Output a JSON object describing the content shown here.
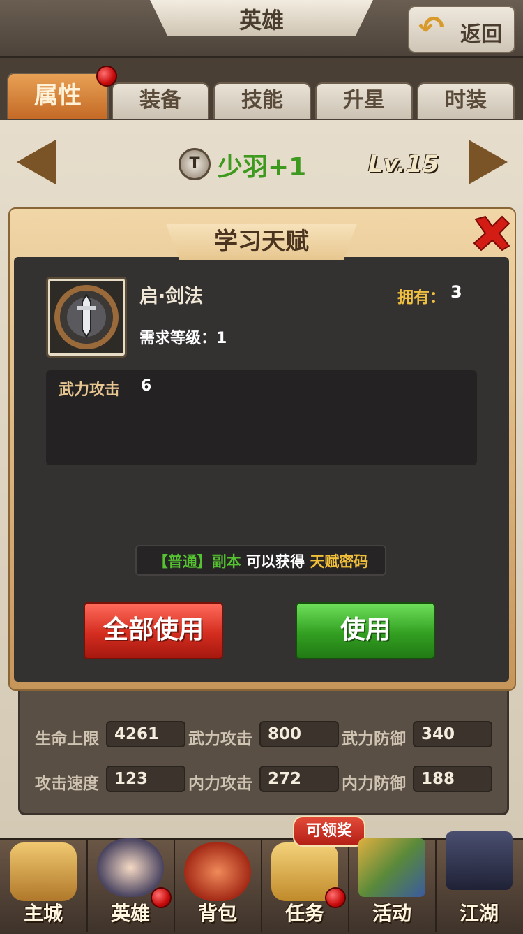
{
  "header": {
    "title": "英雄",
    "back_label": "返回"
  },
  "tabs": [
    {
      "label": "属性",
      "active": true
    },
    {
      "label": "装备"
    },
    {
      "label": "技能"
    },
    {
      "label": "升星"
    },
    {
      "label": "时装"
    }
  ],
  "hero": {
    "rank_icon_text": "T",
    "name": "少羽+1",
    "level": "Lv.15"
  },
  "dialog": {
    "title": "学习天赋",
    "item_name": "启·剑法",
    "own_label": "拥有：",
    "own_value": "3",
    "required_level": "需求等级：1",
    "effect_stat": "武力攻击",
    "effect_value": "6",
    "source": {
      "part1": "【普通】副本",
      "part2": " 可以获得 ",
      "part3": "天赋密码"
    },
    "use_all_label": "全部使用",
    "use_label": "使用"
  },
  "stats": [
    {
      "label": "生命上限",
      "value": "4261"
    },
    {
      "label": "武力攻击",
      "value": "800"
    },
    {
      "label": "武力防御",
      "value": "340"
    },
    {
      "label": "攻击速度",
      "value": "123"
    },
    {
      "label": "内力攻击",
      "value": "272"
    },
    {
      "label": "内力防御",
      "value": "188"
    }
  ],
  "bottom_nav": [
    {
      "label": "主城",
      "icon": "ship-icon"
    },
    {
      "label": "英雄",
      "icon": "hero-portrait-icon"
    },
    {
      "label": "背包",
      "icon": "bag-icon"
    },
    {
      "label": "任务",
      "icon": "scroll-icon"
    },
    {
      "label": "活动",
      "icon": "gem-crate-icon"
    },
    {
      "label": "江湖",
      "icon": "lantern-icon"
    }
  ],
  "claim_badge": "可领奖",
  "colors": {
    "tab_active": "#d97a30",
    "hero_name": "#3e9a1e",
    "use_all": "#d42d1f",
    "use": "#339f22",
    "own": "#f0c040"
  }
}
